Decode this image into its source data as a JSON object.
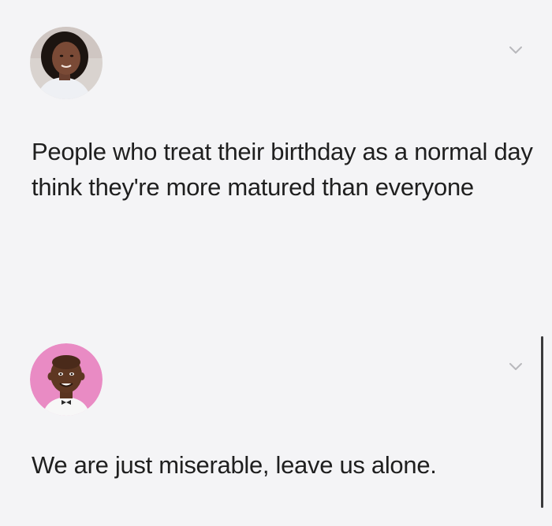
{
  "tweets": [
    {
      "avatar_icon": "woman-portrait-avatar",
      "menu_icon": "chevron-down-icon",
      "text": "People who treat their birthday as a normal day think they're more matured than everyone"
    },
    {
      "avatar_icon": "bitmoji-man-avatar",
      "menu_icon": "chevron-down-icon",
      "text": "We are just miserable, leave us alone."
    }
  ],
  "colors": {
    "background": "#f4f4f6",
    "text": "#1f1f1f",
    "chevron": "#b8b8bc",
    "avatar2_background": "#e98bc4"
  }
}
